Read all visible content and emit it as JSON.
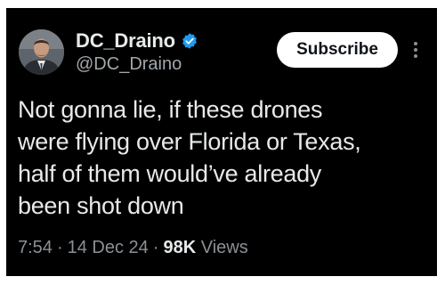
{
  "tweet": {
    "author": {
      "display_name": "DC_Draino",
      "handle": "@DC_Draino",
      "verified_icon": "verified-badge-icon",
      "avatar_icon": "avatar"
    },
    "subscribe_label": "Subscribe",
    "more_icon": "more-options-icon",
    "text_lines": [
      "Not gonna lie, if these drones",
      "were flying over Florida or Texas,",
      "half of them would’ve already",
      "been shot down"
    ],
    "meta": {
      "time": "7:54",
      "separator": "·",
      "date": "14 Dec 24",
      "views_count": "98K",
      "views_label": "Views"
    }
  },
  "colors": {
    "background": "#000000",
    "text": "#e7e9ea",
    "secondary_text": "#8b9095",
    "verified": "#1d9bf0",
    "button_bg": "#ffffff",
    "button_text": "#0f1419"
  }
}
